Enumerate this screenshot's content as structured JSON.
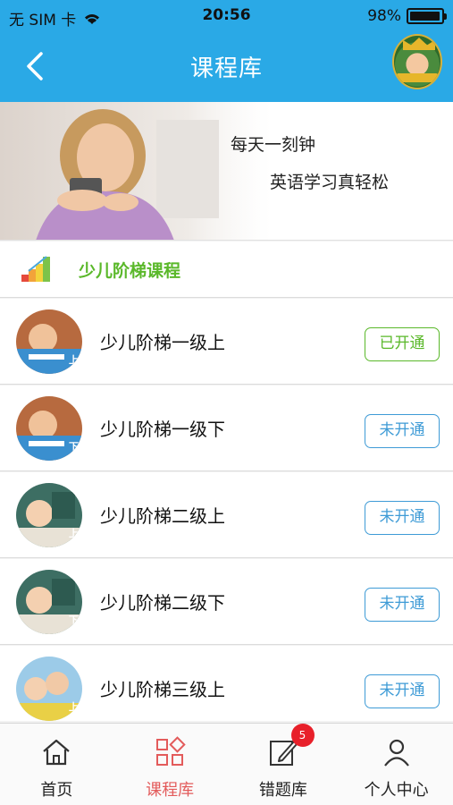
{
  "status": {
    "carrier": "无 SIM 卡",
    "time": "20:56",
    "battery": "98%",
    "battery_level": 0.98
  },
  "nav": {
    "title": "课程库"
  },
  "banner": {
    "line1": "每天一刻钟",
    "line2": "英语学习真轻松"
  },
  "section": {
    "label": "少儿阶梯课程"
  },
  "courses": [
    {
      "name": "少儿阶梯一级上",
      "tag": "上",
      "status": "已开通",
      "opened": true
    },
    {
      "name": "少儿阶梯一级下",
      "tag": "下",
      "status": "未开通",
      "opened": false
    },
    {
      "name": "少儿阶梯二级上",
      "tag": "上",
      "status": "未开通",
      "opened": false
    },
    {
      "name": "少儿阶梯二级下",
      "tag": "下",
      "status": "未开通",
      "opened": false
    },
    {
      "name": "少儿阶梯三级上",
      "tag": "上",
      "status": "未开通",
      "opened": false
    }
  ],
  "tabs": [
    {
      "label": "首页",
      "icon": "home-icon"
    },
    {
      "label": "课程库",
      "icon": "grid-icon",
      "active": true
    },
    {
      "label": "错题库",
      "icon": "edit-icon",
      "badge": "5"
    },
    {
      "label": "个人中心",
      "icon": "person-icon"
    }
  ],
  "colors": {
    "accent": "#2aa9e6",
    "green": "#5ab82a",
    "blue_button": "#3e9bd6",
    "active_tab": "#e35b5b",
    "badge": "#e8202a"
  }
}
